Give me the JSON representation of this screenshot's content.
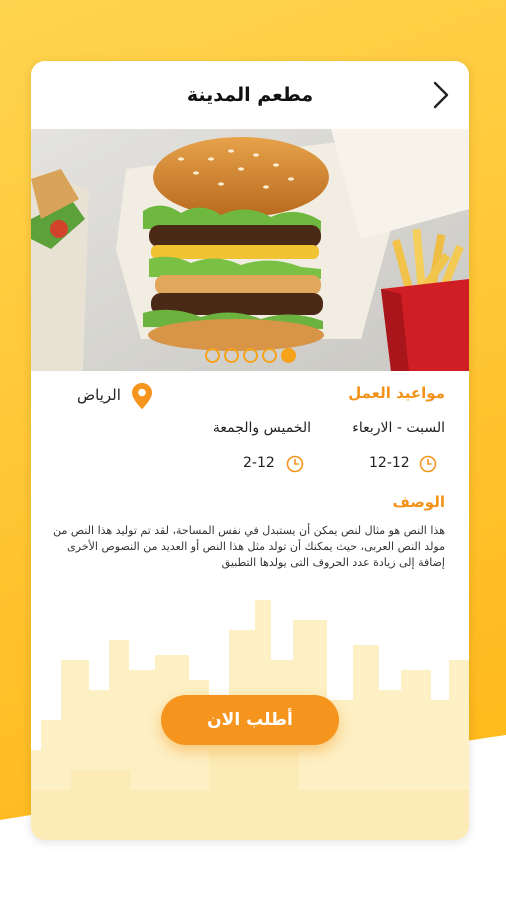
{
  "header": {
    "title": "مطعم المدينة"
  },
  "carousel": {
    "dots": [
      false,
      false,
      false,
      false,
      true
    ]
  },
  "hours": {
    "title": "مواعيد العمل",
    "location": "الرياض",
    "rows": [
      {
        "days": "السبت - الاربعاء",
        "time": "12-12"
      },
      {
        "days": "الخميس والجمعة",
        "time": "2-12"
      }
    ]
  },
  "description": {
    "title": "الوصف",
    "text": "هذا النص هو مثال لنص يمكن أن يستبدل في نفس المساحة، لقد تم توليد هذا النص من مولد النص العربى، حيث يمكنك أن تولد مثل هذا النص أو العديد من النصوص الأخرى إضافة إلى زيادة عدد الحروف التى يولدها التطبيق"
  },
  "actions": {
    "order_label": "أطلب الان"
  },
  "colors": {
    "accent": "#f6951d",
    "background": "#ffc12b"
  },
  "icons": {
    "back": "chevron-right-icon",
    "location": "map-pin-icon",
    "clock": "clock-icon"
  }
}
